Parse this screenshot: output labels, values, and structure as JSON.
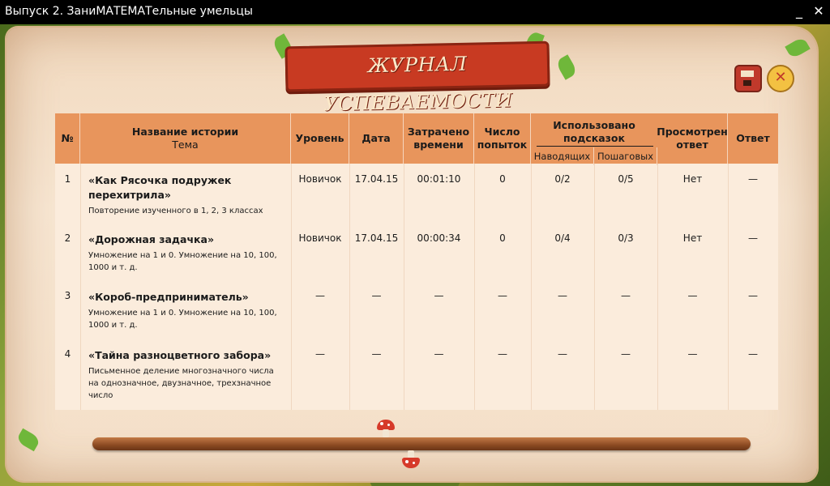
{
  "window": {
    "title": "Выпуск 2. ЗаниМАТЕМАТельные умельцы",
    "minimize": "_",
    "close": "✕"
  },
  "banner": {
    "title": "ЖУРНАЛ УСПЕВАЕМОСТИ"
  },
  "toolbar": {
    "save_icon": "save-icon",
    "close_label": "✕"
  },
  "table": {
    "headers": {
      "num": "№",
      "story": "Название истории",
      "topic": "Тема",
      "level": "Уровень",
      "date": "Дата",
      "time": "Затрачено времени",
      "attempts": "Число попыток",
      "hints": "Использовано подсказок",
      "hints_leading": "Наводящих",
      "hints_step": "Пошаговых",
      "viewed": "Просмотрен ответ",
      "answer": "Ответ"
    },
    "rows": [
      {
        "num": "1",
        "name": "«Как Рясочка подружек перехитрила»",
        "topic": "Повторение изученного в 1, 2, 3 классах",
        "level": "Новичок",
        "date": "17.04.15",
        "time": "00:01:10",
        "attempts": "0",
        "leading": "0/2",
        "step": "0/5",
        "viewed": "Нет",
        "answer": "—"
      },
      {
        "num": "2",
        "name": "«Дорожная задачка»",
        "topic": "Умножение на 1 и 0. Умножение на 10, 100, 1000 и т. д.",
        "level": "Новичок",
        "date": "17.04.15",
        "time": "00:00:34",
        "attempts": "0",
        "leading": "0/4",
        "step": "0/3",
        "viewed": "Нет",
        "answer": "—"
      },
      {
        "num": "3",
        "name": "«Короб-предприниматель»",
        "topic": "Умножение на 1 и 0. Умножение на 10, 100, 1000 и т. д.",
        "level": "—",
        "date": "—",
        "time": "—",
        "attempts": "—",
        "leading": "—",
        "step": "—",
        "viewed": "—",
        "answer": "—"
      },
      {
        "num": "4",
        "name": "«Тайна разноцветного забора»",
        "topic": "Письменное деление многозначного числа на однозначное, двузначное, трехзначное число",
        "level": "—",
        "date": "—",
        "time": "—",
        "attempts": "—",
        "leading": "—",
        "step": "—",
        "viewed": "—",
        "answer": "—"
      }
    ]
  },
  "scrollbar": {
    "position": 0.5
  }
}
